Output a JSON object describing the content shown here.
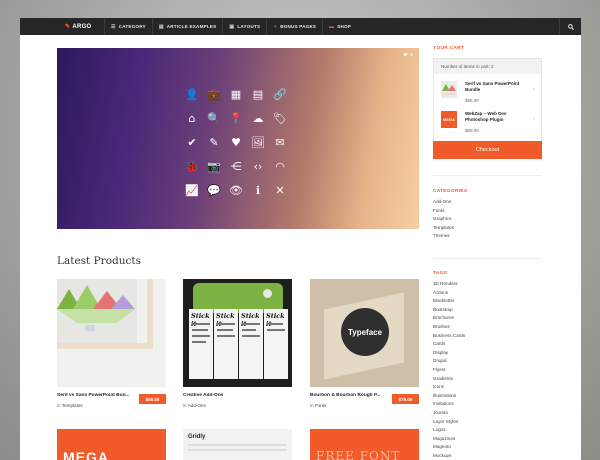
{
  "nav": {
    "brand": "ARGO",
    "items": [
      {
        "label": "CATEGORY",
        "icon": "menu-icon",
        "glyph": "☰"
      },
      {
        "label": "ARTICLE EXAMPLES",
        "icon": "document-icon",
        "glyph": "▤"
      },
      {
        "label": "LAYOUTS",
        "icon": "layout-icon",
        "glyph": "▣"
      },
      {
        "label": "BONUS PAGES",
        "icon": "sitemap-icon",
        "glyph": "♆"
      },
      {
        "label": "SHOP",
        "icon": "cart-icon",
        "glyph": "▬"
      }
    ],
    "search_icon": "search-icon"
  },
  "hero": {
    "icons": [
      {
        "name": "user-icon",
        "glyph": "👤"
      },
      {
        "name": "briefcase-icon",
        "glyph": "💼"
      },
      {
        "name": "calendar-icon",
        "glyph": "▦"
      },
      {
        "name": "document-icon",
        "glyph": "▤"
      },
      {
        "name": "link-icon",
        "glyph": "🔗"
      },
      {
        "name": "home-icon",
        "glyph": "⌂"
      },
      {
        "name": "search-icon",
        "glyph": "🔍"
      },
      {
        "name": "location-pin-icon",
        "glyph": "📍"
      },
      {
        "name": "cloud-icon",
        "glyph": "☁"
      },
      {
        "name": "tag-icon",
        "glyph": "🏷"
      },
      {
        "name": "check-icon",
        "glyph": "✔"
      },
      {
        "name": "pencil-icon",
        "glyph": "✎"
      },
      {
        "name": "heart-icon",
        "glyph": "♥"
      },
      {
        "name": "image-icon",
        "glyph": "🖼"
      },
      {
        "name": "mail-icon",
        "glyph": "✉"
      },
      {
        "name": "bug-icon",
        "glyph": "🐞"
      },
      {
        "name": "camera-icon",
        "glyph": "📷"
      },
      {
        "name": "share-icon",
        "glyph": "⋲"
      },
      {
        "name": "code-icon",
        "glyph": "‹›"
      },
      {
        "name": "rss-icon",
        "glyph": "◠"
      },
      {
        "name": "chart-icon",
        "glyph": "📈"
      },
      {
        "name": "chat-icon",
        "glyph": "💬"
      },
      {
        "name": "eye-icon",
        "glyph": "👁"
      },
      {
        "name": "info-icon",
        "glyph": "ℹ"
      },
      {
        "name": "close-icon",
        "glyph": "✕"
      }
    ]
  },
  "latest": {
    "title": "Latest Products",
    "products": [
      {
        "name": "Serif vs Sans PowerPoint Bun...",
        "category_prefix": "in ",
        "category": "Templates",
        "price": "$55.00"
      },
      {
        "name": "Creative Add-Ons",
        "category_prefix": "in ",
        "category": "Add-Ons",
        "price": ""
      },
      {
        "name": "Bourbon & Bourbon Rough P...",
        "category_prefix": "in ",
        "category": "Fonts",
        "price": "$79.00"
      }
    ],
    "thumb_texts": {
      "stickit": "Stick it",
      "typeface": "Typeface",
      "mega": "MEGA",
      "gridly": "Gridly",
      "free_font": "FREE FONT"
    }
  },
  "cart": {
    "heading": "YOUR CART",
    "count_text": "Number of items in cart: 2",
    "items": [
      {
        "title": "Serif vs Sans PowerPoint Bundle",
        "price": "$55.00",
        "thumb_text": ""
      },
      {
        "title": "WebZap – Web Dev Photoshop Plugin",
        "price": "$80.00",
        "thumb_text": "MEGA"
      }
    ],
    "remove_glyph": "×",
    "checkout_label": "Checkout"
  },
  "categories": {
    "heading": "CATEGORIES",
    "items": [
      "Add-Ons",
      "Fonts",
      "Graphics",
      "Templates",
      "Themes"
    ]
  },
  "tags": {
    "heading": "TAGS",
    "items": [
      "3D Renders",
      "Actions",
      "Blackletter",
      "Bootstrap",
      "Brochures",
      "Brushes",
      "Business Cards",
      "Cards",
      "Display",
      "Drupal",
      "Flyers",
      "Gradients",
      "Icons",
      "Illustrations",
      "Invitations",
      "Joomla",
      "Layer Styles",
      "Logos",
      "Magazines",
      "Magento",
      "Mockups"
    ]
  },
  "colors": {
    "accent": "#f15a29",
    "nav_bg": "#262626"
  }
}
